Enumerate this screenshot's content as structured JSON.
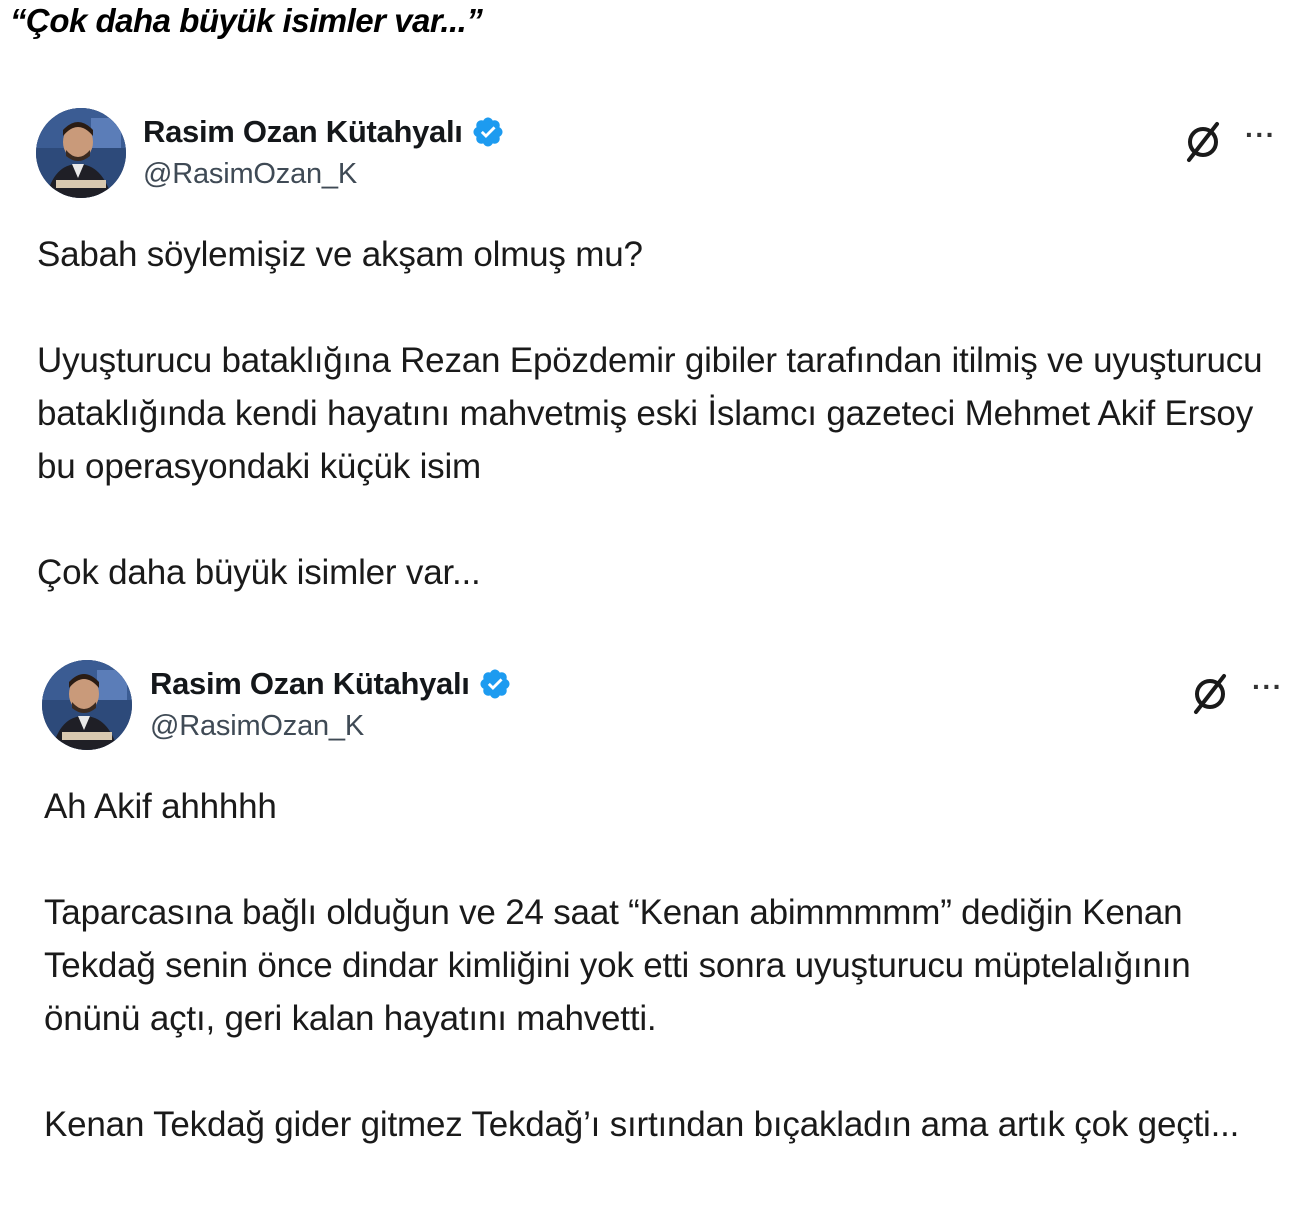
{
  "headline": "“Çok daha büyük isimler var...”",
  "accent_color": "#1d9bf0",
  "tweets": [
    {
      "display_name": "Rasim Ozan Kütahyalı",
      "handle": "@RasimOzan_K",
      "paragraphs": [
        "Sabah söylemişiz ve akşam olmuş mu?",
        "Uyuşturucu bataklığına Rezan Epözdemir gibiler tarafından itilmiş ve uyuşturucu bataklığında kendi hayatını mahvetmiş eski İslamcı gazeteci Mehmet Akif Ersoy bu operasyondaki küçük isim",
        "Çok daha büyük isimler var..."
      ],
      "icons": [
        "avatar",
        "verified-badge-icon",
        "grok-icon",
        "more-icon"
      ]
    },
    {
      "display_name": "Rasim Ozan Kütahyalı",
      "handle": "@RasimOzan_K",
      "paragraphs": [
        "Ah Akif ahhhhh",
        "Taparcasına bağlı olduğun ve 24 saat “Kenan abimmmmm” dediğin Kenan Tekdağ senin önce dindar kimliğini yok etti sonra uyuşturucu müptelalığının önünü açtı, geri kalan hayatını mahvetti.",
        "Kenan Tekdağ gider gitmez Tekdağ’ı sırtından bıçakladın ama artık çok geçti..."
      ],
      "icons": [
        "avatar",
        "verified-badge-icon",
        "grok-icon",
        "more-icon"
      ]
    }
  ]
}
